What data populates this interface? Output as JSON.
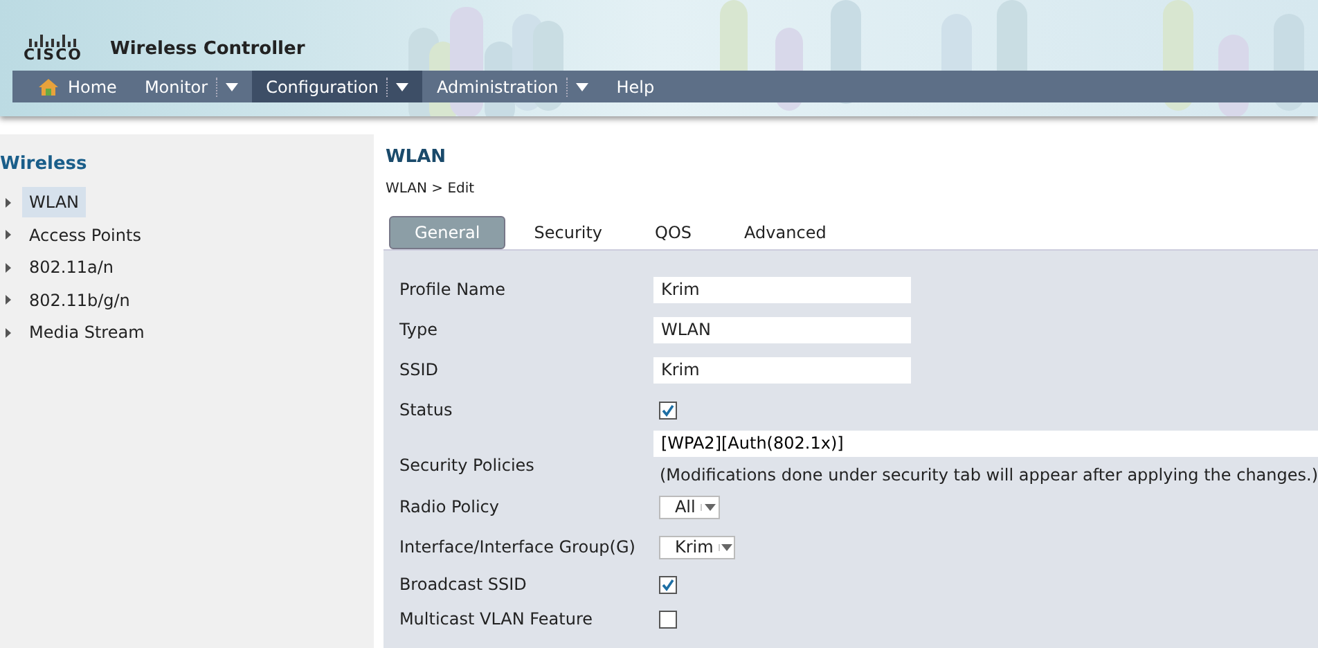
{
  "header": {
    "brand": "CISCO",
    "title": "Wireless Controller"
  },
  "nav": [
    {
      "label": "Home",
      "kind": "home",
      "selected": false
    },
    {
      "label": "Monitor",
      "kind": "menu",
      "selected": false
    },
    {
      "label": "Configuration",
      "kind": "menu",
      "selected": true
    },
    {
      "label": "Administration",
      "kind": "menu",
      "selected": false
    },
    {
      "label": "Help",
      "kind": "plain",
      "selected": false
    }
  ],
  "sidebar": {
    "title": "Wireless",
    "items": [
      {
        "label": "WLAN",
        "selected": true
      },
      {
        "label": "Access Points",
        "selected": false
      },
      {
        "label": "802.11a/n",
        "selected": false
      },
      {
        "label": "802.11b/g/n",
        "selected": false
      },
      {
        "label": "Media Stream",
        "selected": false
      }
    ]
  },
  "page": {
    "title": "WLAN",
    "breadcrumb": "WLAN > Edit"
  },
  "tabs": [
    {
      "label": "General",
      "selected": true
    },
    {
      "label": "Security",
      "selected": false
    },
    {
      "label": "QOS",
      "selected": false
    },
    {
      "label": "Advanced",
      "selected": false
    }
  ],
  "fields": [
    {
      "label": "Profile Name",
      "kind": "text",
      "value": "Krim"
    },
    {
      "label": "Type",
      "kind": "text",
      "value": "WLAN"
    },
    {
      "label": "SSID",
      "kind": "text",
      "value": "Krim"
    },
    {
      "label": "Status",
      "kind": "checkbox",
      "checked": true
    },
    {
      "label": "Security Policies",
      "kind": "policy",
      "value": "[WPA2][Auth(802.1x)]",
      "note": "(Modifications done under security tab will appear after applying the changes.)"
    },
    {
      "label": "Radio Policy",
      "kind": "select",
      "value": "All"
    },
    {
      "label": "Interface/Interface Group(G)",
      "kind": "select",
      "value": "Krim"
    },
    {
      "label": "Broadcast SSID",
      "kind": "checkbox",
      "checked": true
    },
    {
      "label": "Multicast VLAN Feature",
      "kind": "checkbox",
      "checked": false
    }
  ]
}
